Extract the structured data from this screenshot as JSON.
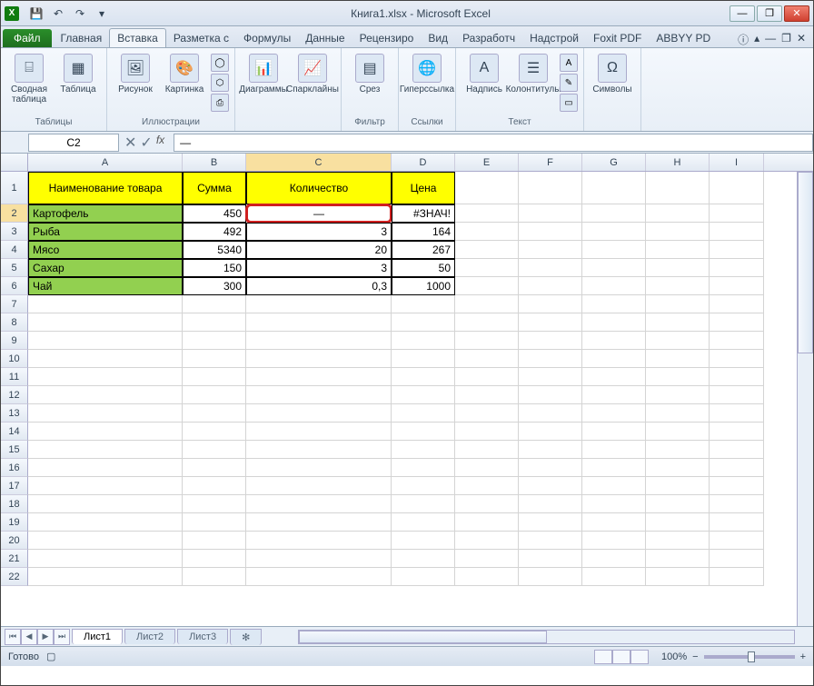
{
  "title": "Книга1.xlsx - Microsoft Excel",
  "qat": {
    "save": "💾",
    "undo": "↶",
    "redo": "↷",
    "more": "▾"
  },
  "win": {
    "min": "—",
    "max": "❐",
    "close": "✕"
  },
  "tabs": {
    "file": "Файл",
    "items": [
      "Главная",
      "Вставка",
      "Разметка с",
      "Формулы",
      "Данные",
      "Рецензиро",
      "Вид",
      "Разработч",
      "Надстрой",
      "Foxit PDF",
      "ABBYY PD"
    ]
  },
  "ribbon": {
    "tables": {
      "label": "Таблицы",
      "pivot": "Сводная таблица",
      "table": "Таблица"
    },
    "illus": {
      "label": "Иллюстрации",
      "pic": "Рисунок",
      "clip": "Картинка"
    },
    "charts": {
      "label": " ",
      "charts": "Диаграммы",
      "spark": "Спарклайны"
    },
    "filter": {
      "label": "Фильтр",
      "slicer": "Срез"
    },
    "links": {
      "label": "Ссылки",
      "hyper": "Гиперссылка"
    },
    "text": {
      "label": "Текст",
      "textbox": "Надпись",
      "header": "Колонтитулы"
    },
    "symbols": {
      "label": " ",
      "symbol": "Символы"
    }
  },
  "namebox": "C2",
  "fx": "fx",
  "formula": "—",
  "cols": [
    "A",
    "B",
    "C",
    "D",
    "E",
    "F",
    "G",
    "H",
    "I"
  ],
  "headers": {
    "A": "Наименование товара",
    "B": "Сумма",
    "C": "Количество",
    "D": "Цена"
  },
  "rows": [
    {
      "n": "2",
      "A": "Картофель",
      "B": "450",
      "C": "—",
      "D": "#ЗНАЧ!"
    },
    {
      "n": "3",
      "A": "Рыба",
      "B": "492",
      "C": "3",
      "D": "164"
    },
    {
      "n": "4",
      "A": "Мясо",
      "B": "5340",
      "C": "20",
      "D": "267"
    },
    {
      "n": "5",
      "A": "Сахар",
      "B": "150",
      "C": "3",
      "D": "50"
    },
    {
      "n": "6",
      "A": "Чай",
      "B": "300",
      "C": "0,3",
      "D": "1000"
    }
  ],
  "emptyrows": [
    "7",
    "8",
    "9",
    "10",
    "11",
    "12",
    "13",
    "14",
    "15",
    "16",
    "17",
    "18",
    "19",
    "20",
    "21",
    "22"
  ],
  "sheets": [
    "Лист1",
    "Лист2",
    "Лист3"
  ],
  "status": "Готово",
  "zoom": "100%"
}
